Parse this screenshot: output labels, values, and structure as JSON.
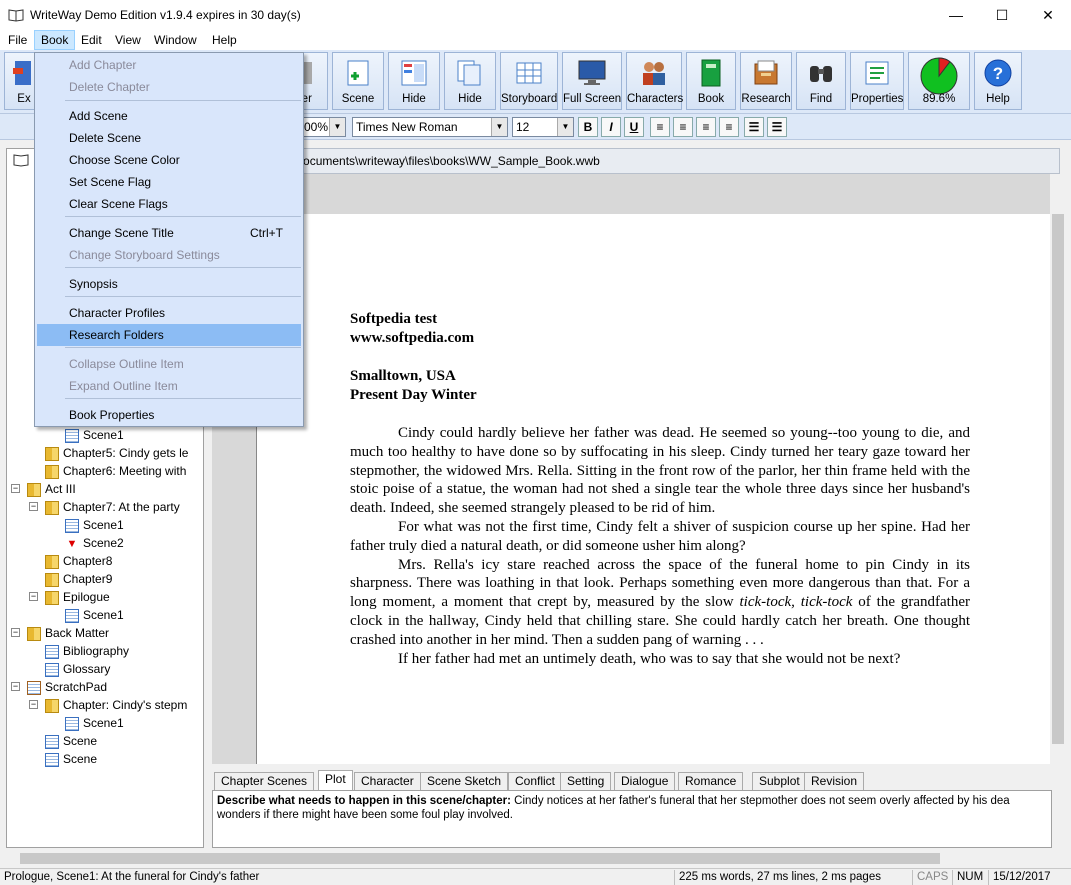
{
  "window": {
    "title": "WriteWay Demo Edition v1.9.4  expires in 30 day(s)",
    "minimize": "—",
    "maximize": "☐",
    "close": "✕"
  },
  "menubar": [
    "File",
    "Book",
    "Edit",
    "View",
    "Window",
    "Help"
  ],
  "toolbar": {
    "buttons": [
      {
        "label": "Ex",
        "icon": "exit-icon"
      },
      {
        "label": "pter",
        "icon": "chapter-icon"
      },
      {
        "label": "Scene",
        "icon": "scene-icon"
      },
      {
        "label": "Hide",
        "icon": "hide-outline-icon"
      },
      {
        "label": "Hide",
        "icon": "hide-pages-icon"
      },
      {
        "label": "Storyboard",
        "icon": "storyboard-icon"
      },
      {
        "label": "Full Screen",
        "icon": "monitor-icon"
      },
      {
        "label": "Characters",
        "icon": "characters-icon"
      },
      {
        "label": "Book",
        "icon": "book-icon"
      },
      {
        "label": "Research",
        "icon": "research-icon"
      },
      {
        "label": "Find",
        "icon": "binoculars-icon"
      },
      {
        "label": "Properties",
        "icon": "properties-icon"
      },
      {
        "label": "89.6%",
        "icon": "progress-pie-icon",
        "progress": 89.6
      },
      {
        "label": "Help",
        "icon": "help-icon"
      }
    ]
  },
  "format": {
    "zoom": "00%",
    "font": "Times New Roman",
    "size": "12",
    "bold": "B",
    "italic": "I",
    "underline": "U"
  },
  "path": "blic\\documents\\writeway\\files\\books\\WW_Sample_Book.wwb",
  "book_menu": {
    "items": [
      {
        "label": "Add Chapter",
        "disabled": true
      },
      {
        "label": "Delete Chapter",
        "disabled": true
      },
      {
        "label": "Add Scene",
        "disabled": false
      },
      {
        "label": "Delete Scene",
        "disabled": false
      },
      {
        "label": "Choose Scene Color",
        "disabled": false
      },
      {
        "label": "Set Scene Flag",
        "disabled": false
      },
      {
        "label": "Clear Scene Flags",
        "disabled": false
      },
      {
        "label": "Change Scene Title",
        "shortcut": "Ctrl+T",
        "disabled": false
      },
      {
        "label": "Change Storyboard Settings",
        "disabled": true
      },
      {
        "label": "Synopsis",
        "disabled": false
      },
      {
        "label": "Character Profiles",
        "disabled": false
      },
      {
        "label": "Research Folders",
        "disabled": false,
        "highlighted": true
      },
      {
        "label": "Collapse Outline Item",
        "disabled": true
      },
      {
        "label": "Expand Outline Item",
        "disabled": true
      },
      {
        "label": "Book Properties",
        "disabled": false
      }
    ]
  },
  "tree": [
    {
      "label": "Scene1",
      "type": "page"
    },
    {
      "label": "Chapter5: Cindy gets le",
      "type": "folder"
    },
    {
      "label": "Chapter6: Meeting with",
      "type": "folder"
    },
    {
      "label": "Act III",
      "type": "folder"
    },
    {
      "label": "Chapter7: At the party",
      "type": "folder"
    },
    {
      "label": "Scene1",
      "type": "page"
    },
    {
      "label": "Scene2",
      "type": "flag"
    },
    {
      "label": "Chapter8",
      "type": "folder"
    },
    {
      "label": "Chapter9",
      "type": "folder"
    },
    {
      "label": "Epilogue",
      "type": "folder"
    },
    {
      "label": "Scene1",
      "type": "page"
    },
    {
      "label": "Back Matter",
      "type": "folder"
    },
    {
      "label": "Bibliography",
      "type": "page"
    },
    {
      "label": "Glossary",
      "type": "page"
    },
    {
      "label": "ScratchPad",
      "type": "pad"
    },
    {
      "label": "Chapter: Cindy's stepm",
      "type": "folder"
    },
    {
      "label": "Scene1",
      "type": "page"
    },
    {
      "label": "Scene",
      "type": "page"
    },
    {
      "label": "Scene",
      "type": "page"
    }
  ],
  "document": {
    "header1": "Softpedia test",
    "header2": "www.softpedia.com",
    "place": "Smalltown, USA",
    "time": "Present Day Winter",
    "p1": "Cindy could hardly believe her father was dead. He seemed so young--too young to die, and much too healthy to have done so by suffocating in his sleep. Cindy turned her teary gaze toward her stepmother, the widowed Mrs. Rella. Sitting in the front row of the parlor, her thin frame held with the stoic poise of a statue, the woman had not shed a single tear the whole three days since her husband's death. Indeed, she seemed strangely pleased to be rid of him.",
    "p2": "For what was not the first time, Cindy felt a shiver of suspicion course up her spine. Had her father truly died a natural death, or did someone usher him along?",
    "p3a": "Mrs. Rella's icy stare reached across the space of the funeral home to pin Cindy in its sharpness. There was loathing in that look. Perhaps something even more dangerous than that. For a long moment, a moment that crept by, measured by the slow ",
    "p3i": "tick-tock, tick-tock",
    "p3b": " of the grandfather clock in the hallway, Cindy held that chilling stare. She could hardly catch her breath. One thought crashed into another in her mind. Then a sudden pang of warning . . .",
    "p4": "If her father had met an untimely death, who was to say that she would not be next?"
  },
  "tabs": [
    "Chapter Scenes",
    "Plot",
    "Character",
    "Scene Sketch",
    "Conflict",
    "Setting",
    "Dialogue",
    "Romance",
    "Subplot",
    "Revision"
  ],
  "active_tab": "Plot",
  "synopsis": {
    "label": "Describe what needs to happen in this scene/chapter:",
    "text1": " Cindy notices at her father's funeral that her stepmother does not seem overly affected by his dea",
    "text2": "wonders if there might have been some foul play involved."
  },
  "status": {
    "location": "Prologue, Scene1: At the funeral for Cindy's father",
    "counts": "225 ms words, 27 ms lines, 2 ms pages",
    "caps": "CAPS",
    "num": "NUM",
    "date": "15/12/2017"
  }
}
